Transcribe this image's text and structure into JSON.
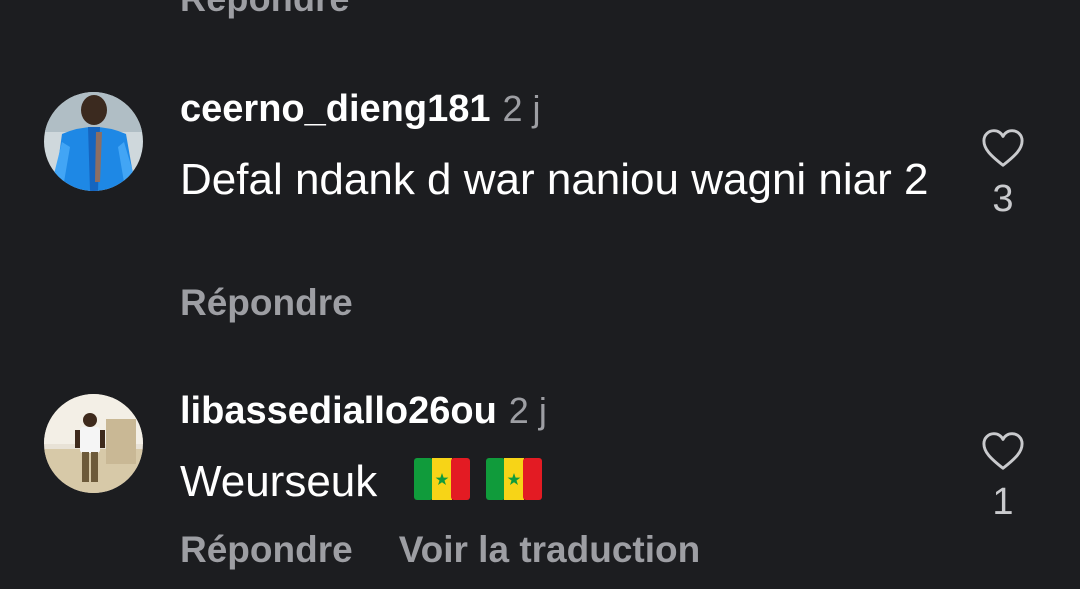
{
  "top_partial": {
    "reply_label": "Répondre"
  },
  "comments": [
    {
      "username": "ceerno_dieng181",
      "time": "2 j",
      "text": "Defal ndank d war naniou wagni niar 2",
      "likes": "3",
      "actions": [
        "Répondre"
      ],
      "avatar": "man-in-blue-robe"
    },
    {
      "username": "libassediallo26ou",
      "time": "2 j",
      "text": "Weurseuk",
      "emoji": [
        "🇸🇳",
        "🇸🇳"
      ],
      "likes": "1",
      "actions": [
        "Répondre",
        "Voir la traduction"
      ],
      "avatar": "man-standing-outdoors"
    }
  ],
  "icons": {
    "like": "heart-outline-icon"
  },
  "colors": {
    "background": "#1c1d20",
    "secondary_text": "#9d9ea3",
    "primary_text": "#ffffff"
  }
}
